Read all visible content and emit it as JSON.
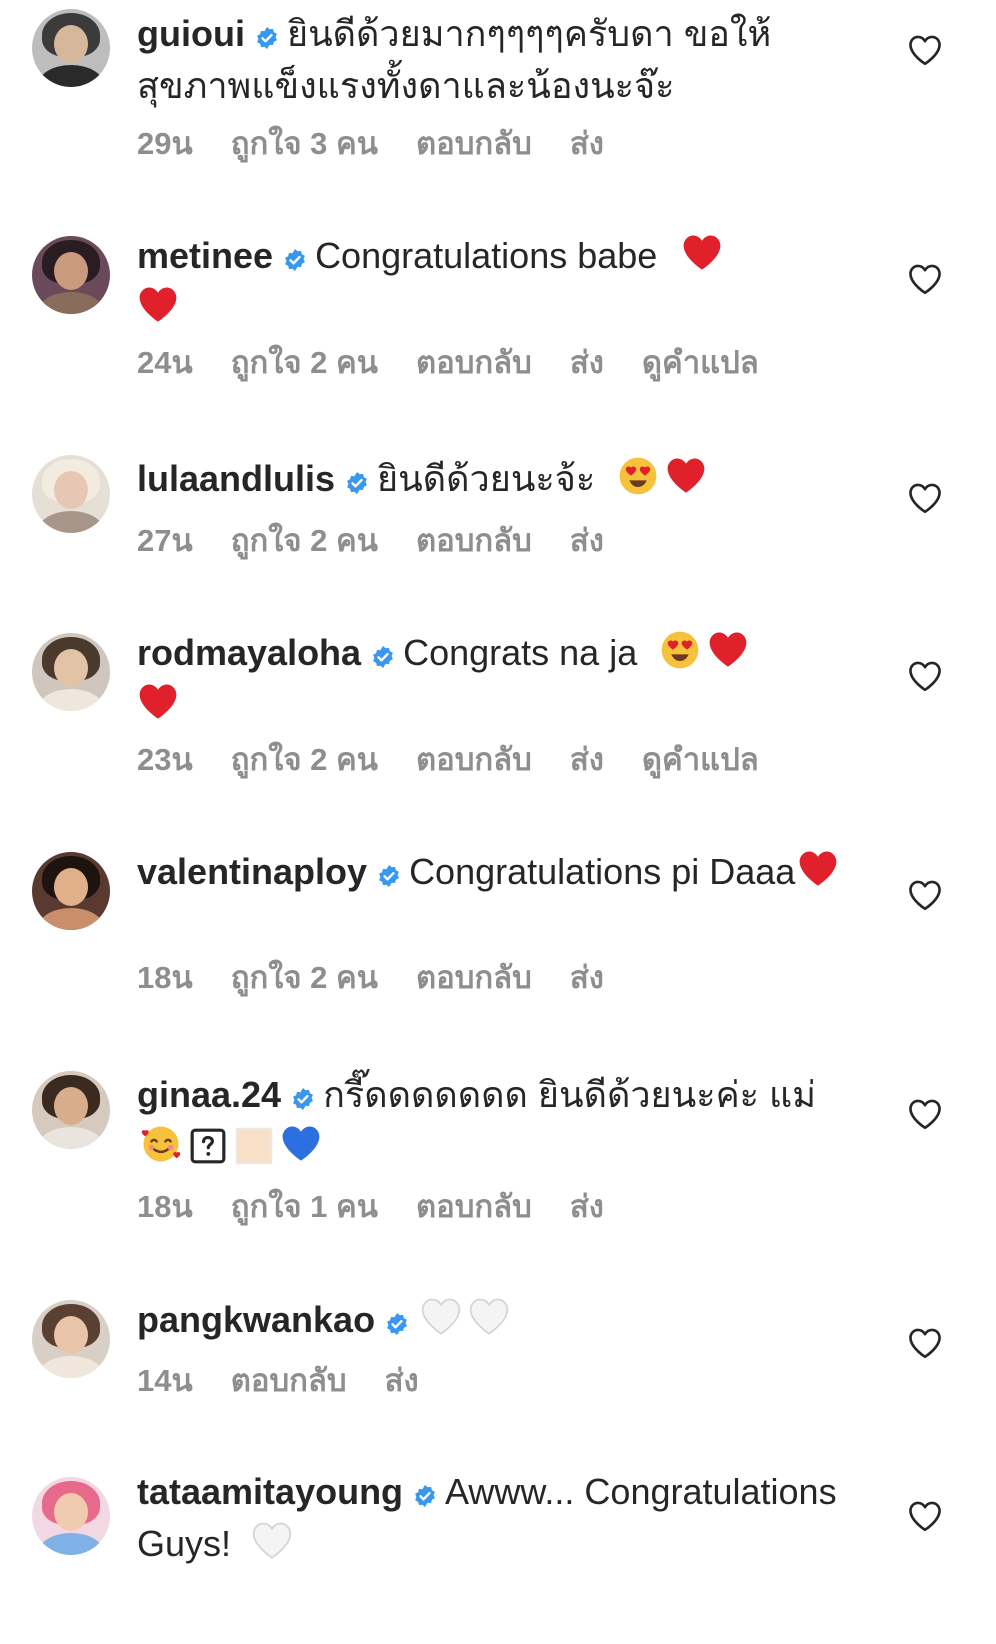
{
  "comments": [
    {
      "username": "guioui",
      "text": "ยินดีด้วยมากๆๆๆๆครับดา ขอให้สุขภาพแข็งแรงทั้งดาและน้องนะจ๊ะ",
      "emojis": [],
      "time": "29น",
      "likes": "ถูกใจ 3 คน",
      "reply": "ตอบกลับ",
      "send": "ส่ง",
      "translate": ""
    },
    {
      "username": "metinee",
      "text": "Congratulations babe",
      "emojis": [
        "red-heart",
        "red-heart"
      ],
      "time": "24น",
      "likes": "ถูกใจ 2 คน",
      "reply": "ตอบกลับ",
      "send": "ส่ง",
      "translate": "ดูคำแปล"
    },
    {
      "username": "lulaandlulis",
      "text": "ยินดีด้วยนะจ้ะ",
      "emojis": [
        "heart-eyes-face",
        "red-heart"
      ],
      "time": "27น",
      "likes": "ถูกใจ 2 คน",
      "reply": "ตอบกลับ",
      "send": "ส่ง",
      "translate": ""
    },
    {
      "username": "rodmayaloha",
      "text": "Congrats na ja",
      "emojis": [
        "heart-eyes-face",
        "red-heart",
        "red-heart"
      ],
      "time": "23น",
      "likes": "ถูกใจ 2 คน",
      "reply": "ตอบกลับ",
      "send": "ส่ง",
      "translate": "ดูคำแปล"
    },
    {
      "username": "valentinaploy",
      "text": "Congratulations pi Daaa",
      "emojis": [
        "red-heart"
      ],
      "time": "18น",
      "likes": "ถูกใจ 2 คน",
      "reply": "ตอบกลับ",
      "send": "ส่ง",
      "translate": ""
    },
    {
      "username": "ginaa.24",
      "text": "กรี๊ดดดดดดด ยินดีด้วยนะค่ะ แม่",
      "emojis": [
        "smiling-face-with-hearts",
        "unknown-glyph-box",
        "skin-tone-swatch",
        "blue-heart"
      ],
      "time": "18น",
      "likes": "ถูกใจ 1 คน",
      "reply": "ตอบกลับ",
      "send": "ส่ง",
      "translate": ""
    },
    {
      "username": "pangkwankao",
      "text": "",
      "emojis": [
        "white-heart",
        "white-heart"
      ],
      "time": "14น",
      "likes": "",
      "reply": "ตอบกลับ",
      "send": "ส่ง",
      "translate": ""
    },
    {
      "username": "tataamitayoung",
      "text": "Awww... Congratulations Guys!",
      "emojis": [
        "white-heart"
      ],
      "time": "",
      "likes": "",
      "reply": "",
      "send": "",
      "translate": ""
    }
  ],
  "icons": {
    "verified_badge": "verified-badge-icon",
    "like": "heart-outline-icon"
  },
  "colors": {
    "verified": "#3897f0",
    "meta_text": "#8e8e8e",
    "text": "#262626",
    "red_heart": "#e0202a",
    "blue_heart": "#2b6fe0"
  }
}
